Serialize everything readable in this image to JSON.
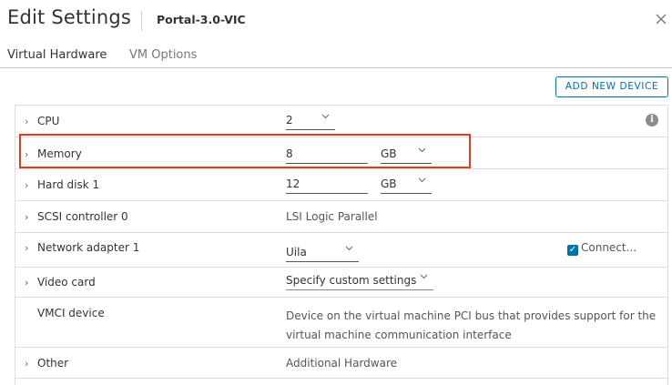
{
  "dialog": {
    "title": "Edit Settings",
    "vm_name": "Portal-3.0-VIC",
    "close_glyph": "✕"
  },
  "tabs": [
    {
      "label": "Virtual Hardware",
      "active": true
    },
    {
      "label": "VM Options",
      "active": false
    }
  ],
  "toolbar": {
    "add_device_label": "ADD NEW DEVICE"
  },
  "rows": {
    "cpu": {
      "label": "CPU",
      "value": "2"
    },
    "memory": {
      "label": "Memory",
      "value": "8",
      "unit": "GB"
    },
    "hard_disk": {
      "label": "Hard disk 1",
      "value": "12",
      "unit": "GB"
    },
    "scsi": {
      "label": "SCSI controller 0",
      "value": "LSI Logic Parallel"
    },
    "network": {
      "label": "Network adapter 1",
      "value": "Uila",
      "connect_label": "Connect...",
      "connected": true
    },
    "video": {
      "label": "Video card",
      "value": "Specify custom settings"
    },
    "vmci": {
      "label": "VMCI device",
      "line1": "Device on the virtual machine PCI bus that provides support for the",
      "line2": "virtual machine communication interface"
    },
    "other": {
      "label": "Other",
      "value": "Additional Hardware"
    }
  },
  "icons": {
    "chevron_right": "›",
    "chevron_down": "⌵",
    "info": "i",
    "check": "✓"
  },
  "colors": {
    "accent": "#0072a3",
    "highlight": "#e03c20",
    "border": "#dddddd"
  }
}
